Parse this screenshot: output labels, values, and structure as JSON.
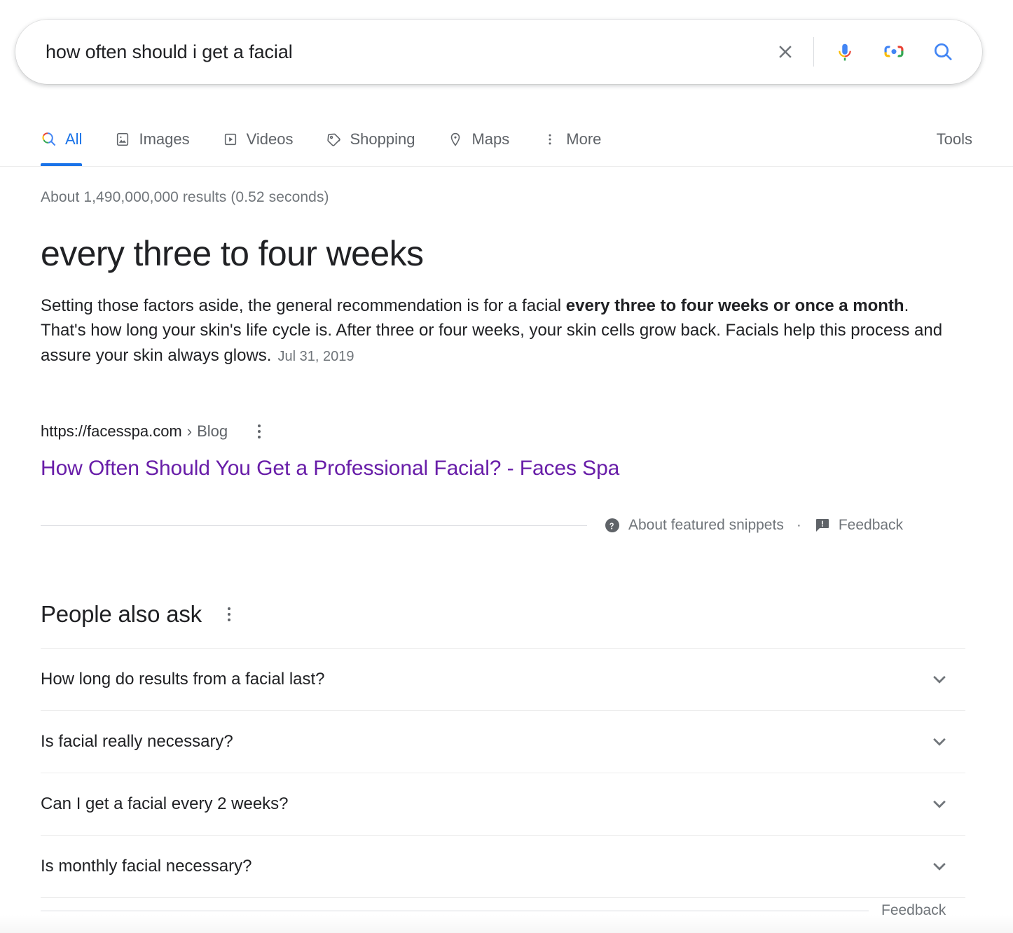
{
  "search": {
    "query": "how often should i get a facial",
    "placeholder": "Search",
    "clear_icon": "close-icon",
    "voice_icon": "microphone-icon",
    "lens_icon": "google-lens-icon",
    "submit_icon": "search-icon"
  },
  "nav": {
    "tabs": [
      {
        "label": "All",
        "icon": "google-search-colored-icon",
        "active": true
      },
      {
        "label": "Images",
        "icon": "image-icon",
        "active": false
      },
      {
        "label": "Videos",
        "icon": "video-play-icon",
        "active": false
      },
      {
        "label": "Shopping",
        "icon": "price-tag-icon",
        "active": false
      },
      {
        "label": "Maps",
        "icon": "map-pin-icon",
        "active": false
      },
      {
        "label": "More",
        "icon": "kebab-menu-icon",
        "active": false
      }
    ],
    "tools_label": "Tools"
  },
  "results": {
    "stats": "About 1,490,000,000 results (0.52 seconds)"
  },
  "featured_snippet": {
    "answer": "every three to four weeks",
    "body_part1": "Setting those factors aside, the general recommendation is for a facial ",
    "body_bold": "every three to four weeks or once a month",
    "body_part2": ". That's how long your skin's life cycle is. After three or four weeks, your skin cells grow back. Facials help this process and assure your skin always glows.",
    "date": "Jul 31, 2019",
    "source_domain": "https://facesspa.com",
    "source_separator": "›",
    "source_path": "Blog",
    "title": "How Often Should You Get a Professional Facial? - Faces Spa",
    "about_label": "About featured snippets",
    "separator_dot": "·",
    "feedback_label": "Feedback"
  },
  "people_also_ask": {
    "title": "People also ask",
    "questions": [
      "How long do results from a facial last?",
      "Is facial really necessary?",
      "Can I get a facial every 2 weeks?",
      "Is monthly facial necessary?"
    ],
    "feedback_label": "Feedback"
  },
  "colors": {
    "google_blue": "#1a73e8",
    "google_red": "#ea4335",
    "google_yellow": "#fbbc04",
    "google_green": "#34a853",
    "visited_link": "#681da8",
    "muted_text": "#70757a",
    "body_text": "#202124"
  }
}
